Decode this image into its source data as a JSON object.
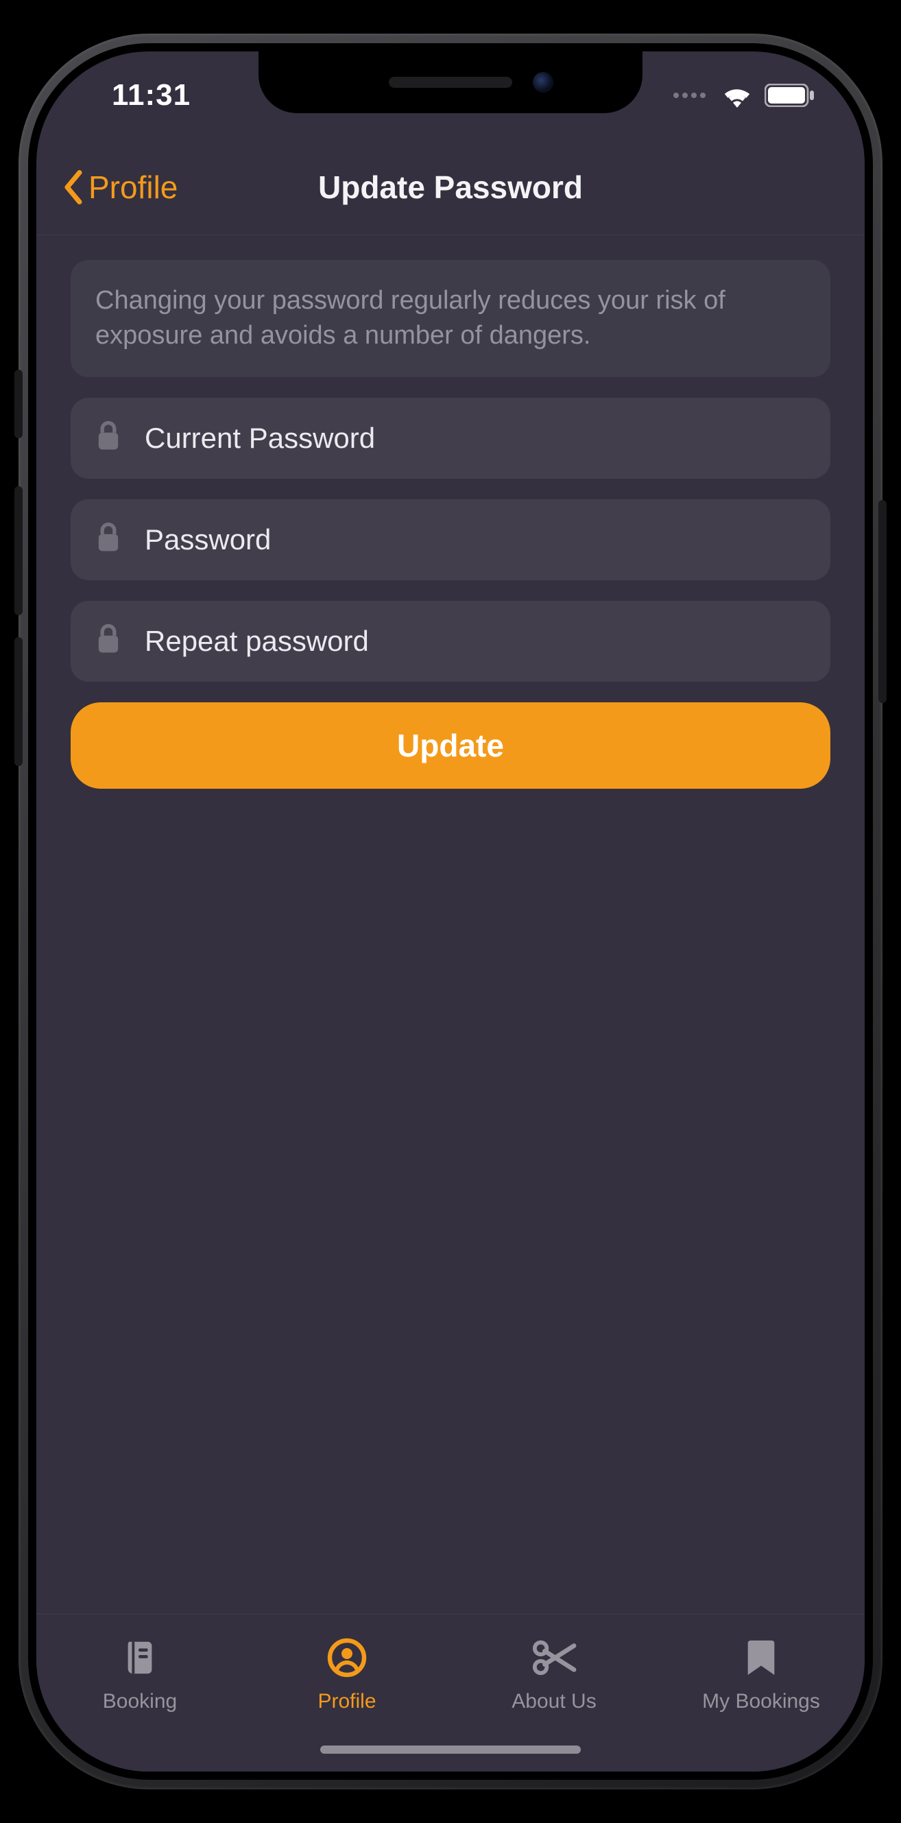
{
  "colors": {
    "accent": "#f49a1a",
    "bg": "#34303f"
  },
  "status": {
    "time": "11:31"
  },
  "nav": {
    "back_label": "Profile",
    "title": "Update Password"
  },
  "info": {
    "text": "Changing your password regularly reduces your risk of exposure and avoids a number of dangers."
  },
  "fields": {
    "current": {
      "placeholder": "Current Password",
      "value": ""
    },
    "password": {
      "placeholder": "Password",
      "value": ""
    },
    "repeat": {
      "placeholder": "Repeat password",
      "value": ""
    }
  },
  "buttons": {
    "update": "Update"
  },
  "tabs": [
    {
      "label": "Booking",
      "icon": "book-icon",
      "active": false
    },
    {
      "label": "Profile",
      "icon": "profile-icon",
      "active": true
    },
    {
      "label": "About Us",
      "icon": "scissors-icon",
      "active": false
    },
    {
      "label": "My Bookings",
      "icon": "bookmark-icon",
      "active": false
    }
  ]
}
